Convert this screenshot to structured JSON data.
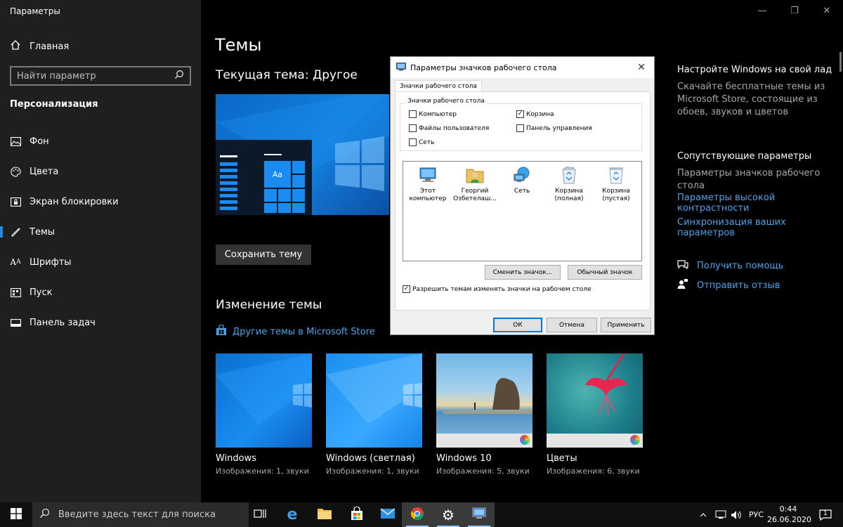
{
  "window": {
    "title": "Параметры",
    "controls": {
      "minimize": "—",
      "maximize": "❐",
      "close": "✕"
    }
  },
  "sidebar": {
    "home_label": "Главная",
    "search_placeholder": "Найти параметр",
    "section_title": "Персонализация",
    "items": [
      {
        "label": "Фон",
        "icon": "image-icon"
      },
      {
        "label": "Цвета",
        "icon": "palette-icon"
      },
      {
        "label": "Экран блокировки",
        "icon": "lock-screen-icon"
      },
      {
        "label": "Темы",
        "icon": "brush-icon",
        "active": true
      },
      {
        "label": "Шрифты",
        "icon": "font-icon"
      },
      {
        "label": "Пуск",
        "icon": "start-icon"
      },
      {
        "label": "Панель задач",
        "icon": "taskbar-icon"
      }
    ]
  },
  "main": {
    "page_title": "Темы",
    "current_theme_title": "Текущая тема: Другое",
    "preview_tile_label": "Aa",
    "save_theme_label": "Сохранить тему",
    "change_theme_title": "Изменение темы",
    "store_link": "Другие темы в Microsoft Store",
    "themes": [
      {
        "name": "Windows",
        "meta": "Изображения: 1, звуки"
      },
      {
        "name": "Windows (светлая)",
        "meta": "Изображения: 1, звуки"
      },
      {
        "name": "Windows 10",
        "meta": "Изображения: 5, звуки"
      },
      {
        "name": "Цветы",
        "meta": "Изображения: 6, звуки"
      }
    ]
  },
  "right": {
    "customize_title": "Настройте Windows на свой лад",
    "customize_text": "Скачайте бесплатные темы из Microsoft Store, состоящие из обоев, звуков и цветов",
    "related_title": "Сопутствующие параметры",
    "related_current": "Параметры значков рабочего стола",
    "link_contrast": "Параметры высокой контрастности",
    "link_sync": "Синхронизация ваших параметров",
    "help": "Получить помощь",
    "feedback": "Отправить отзыв"
  },
  "dialog": {
    "title": "Параметры значков рабочего стола",
    "tab": "Значки рабочего стола",
    "group_label": "Значки рабочего стола",
    "checkboxes": [
      {
        "label": "Компьютер",
        "checked": false
      },
      {
        "label": "Файлы пользователя",
        "checked": false
      },
      {
        "label": "Сеть",
        "checked": false
      },
      {
        "label": "Корзина",
        "checked": true
      },
      {
        "label": "Панель управления",
        "checked": false
      }
    ],
    "icons": [
      {
        "line1": "Этот",
        "line2": "компьютер"
      },
      {
        "line1": "Георгий",
        "line2": "Озбетелаш..."
      },
      {
        "line1": "Сеть",
        "line2": ""
      },
      {
        "line1": "Корзина",
        "line2": "(полная)"
      },
      {
        "line1": "Корзина",
        "line2": "(пустая)"
      }
    ],
    "change_icon_btn": "Сменить значок...",
    "default_icon_btn": "Обычный значок",
    "allow_themes_label": "Разрешить темам изменять значки на рабочем столе",
    "allow_themes_checked": true,
    "ok": "ОК",
    "cancel": "Отмена",
    "apply": "Применить"
  },
  "taskbar": {
    "search_placeholder": "Введите здесь текст для поиска",
    "lang": "РУС",
    "time": "0:44",
    "date": "26.06.2020",
    "notifications": "1"
  },
  "colors": {
    "accent": "#0078d7",
    "link": "#4ba3ec",
    "sidebar_bg": "#1f1f1f"
  }
}
